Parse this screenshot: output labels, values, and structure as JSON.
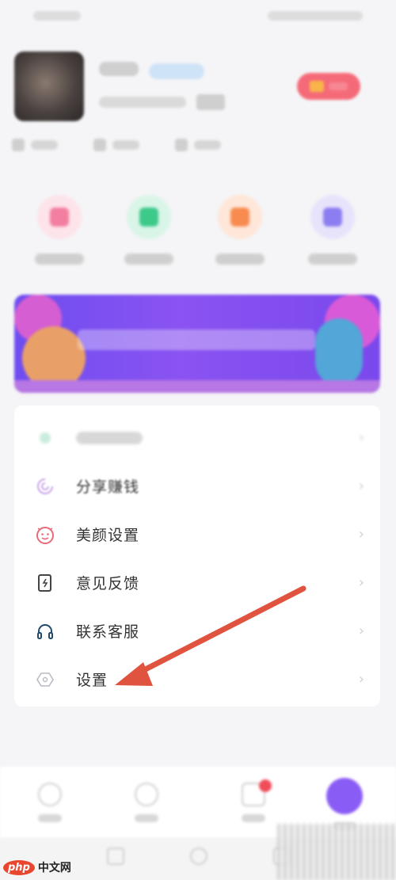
{
  "colors": {
    "accent_purple": "#8a5cf6",
    "arrow_red": "#e0533f",
    "vip_red": "#f56a78",
    "menu_bg": "#ffffff",
    "page_bg": "#f5f5f7"
  },
  "menu": {
    "items": [
      {
        "label": "",
        "icon": "wallet-icon",
        "blurred": true
      },
      {
        "label": "分享赚钱",
        "icon": "share-swirl-icon"
      },
      {
        "label": "美颜设置",
        "icon": "beauty-face-icon"
      },
      {
        "label": "意见反馈",
        "icon": "feedback-note-icon"
      },
      {
        "label": "联系客服",
        "icon": "headset-icon"
      },
      {
        "label": "设置",
        "icon": "settings-hexagon-icon"
      }
    ],
    "chevron": "›"
  },
  "watermark": {
    "logo": "php",
    "text": "中文网"
  },
  "annotation": {
    "type": "red-arrow",
    "points_to": "settings"
  }
}
